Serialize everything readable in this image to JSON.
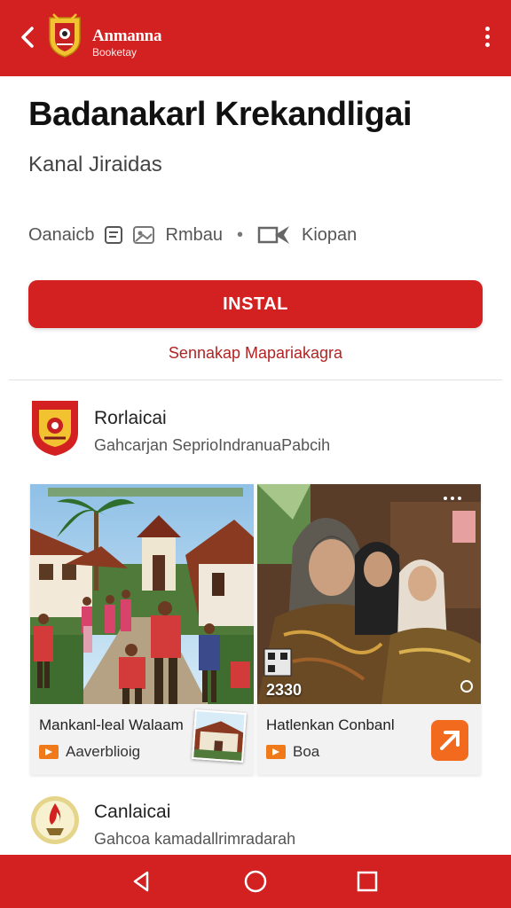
{
  "appbar": {
    "title": "Anmanna",
    "subtitle": "Booketay",
    "icons": [
      "back-arrow-icon",
      "emblem-logo",
      "more-vert-icon"
    ]
  },
  "app": {
    "title": "Badanakarl Krekandligai",
    "developer": "Kanal Jiraidas",
    "meta": {
      "item1": "Oanaicb",
      "item2": "Rmbau",
      "separator": "•",
      "item3": "Kiopan"
    },
    "install_label": "INSTAL",
    "sublink": "Sennakap Mapariakagra"
  },
  "section1": {
    "title": "Rorlaicai",
    "description": "Gahcarjan SeprioIndranuaPabcih"
  },
  "media": [
    {
      "caption": "Mankanl-leal Walaam",
      "tag": "Aaverblioig"
    },
    {
      "caption": "Hatlenkan Conbanl",
      "tag": "Boa",
      "timestamp": "2330"
    }
  ],
  "section2": {
    "title": "Canlaicai",
    "description": "Gahcoa kamadallrimradarah"
  },
  "navbar": {
    "icons": [
      "back-triangle-icon",
      "home-circle-icon",
      "recents-square-icon"
    ]
  },
  "colors": {
    "accent": "#d32020",
    "orange": "#f26a1e"
  }
}
